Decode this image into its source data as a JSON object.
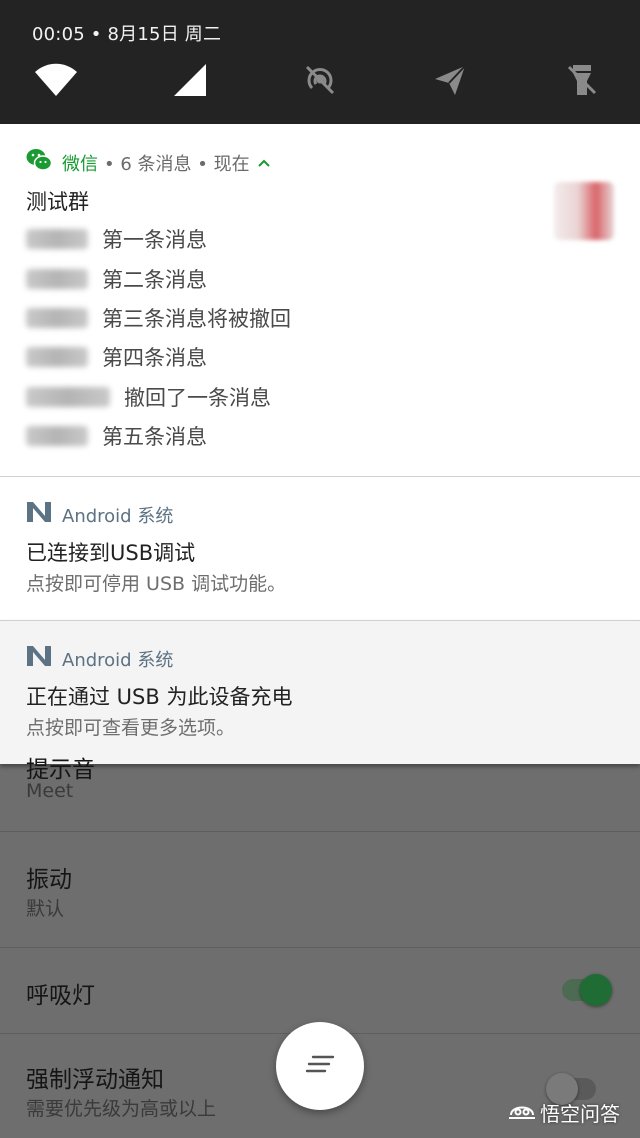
{
  "quick_settings": {
    "header": "00:05 • 8月15日 周二",
    "tiles": [
      "wifi-icon",
      "cell-signal-icon",
      "hotspot-off-icon",
      "airplane-mode-icon",
      "flashlight-off-icon"
    ]
  },
  "notifications": {
    "wechat": {
      "app": "微信",
      "meta": "• 6 条消息 • 现在",
      "title": "测试群",
      "messages": [
        {
          "text": "第一条消息"
        },
        {
          "text": "第二条消息"
        },
        {
          "text": "第三条消息将被撤回"
        },
        {
          "text": "第四条消息"
        },
        {
          "text": "撤回了一条消息"
        },
        {
          "text": "第五条消息"
        }
      ],
      "accent": "#1a9a33"
    },
    "usb_debug": {
      "app": "Android 系统",
      "title": "已连接到USB调试",
      "body": "点按即可停用 USB 调试功能。"
    },
    "usb_charge": {
      "app": "Android 系统",
      "title": "正在通过 USB 为此设备充电",
      "body": "点按即可查看更多选项。"
    }
  },
  "settings": {
    "ringtone": {
      "label_partial": "提示音",
      "value": "Meet"
    },
    "vibration": {
      "label": "振动",
      "value": "默认"
    },
    "breathing_light": {
      "label": "呼吸灯",
      "enabled": true
    },
    "heads_up": {
      "label": "强制浮动通知",
      "sub": "需要优先级为高或以上",
      "enabled": false
    }
  },
  "watermark": "悟空问答"
}
